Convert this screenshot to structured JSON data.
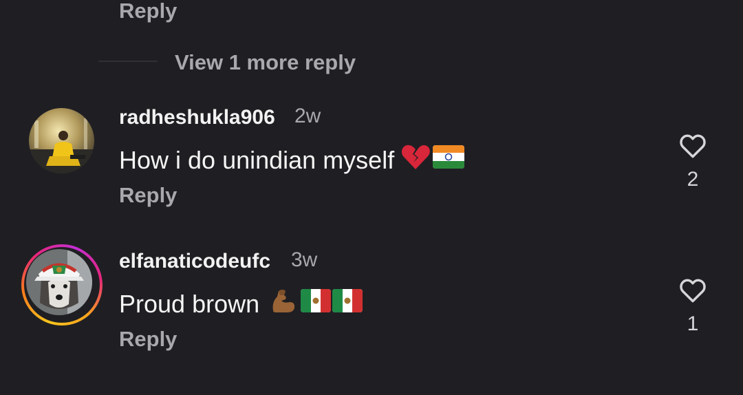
{
  "top": {
    "reply_label": "Reply",
    "view_more_label": "View 1 more reply"
  },
  "comments": [
    {
      "username": "radheshukla906",
      "time": "2w",
      "text": "How i do unindian myself",
      "emojis": [
        "broken-heart",
        "flag-india"
      ],
      "reply_label": "Reply",
      "likes": "2",
      "avatar_story_ring": false
    },
    {
      "username": "elfanaticodeufc",
      "time": "3w",
      "text": "Proud brown",
      "emojis": [
        "flexed-biceps",
        "flag-mexico",
        "flag-mexico"
      ],
      "reply_label": "Reply",
      "likes": "1",
      "avatar_story_ring": true
    }
  ],
  "colors": {
    "background": "#1f1f23",
    "secondary_text": "#a9a9ad",
    "primary_text": "#f2f2f2"
  }
}
